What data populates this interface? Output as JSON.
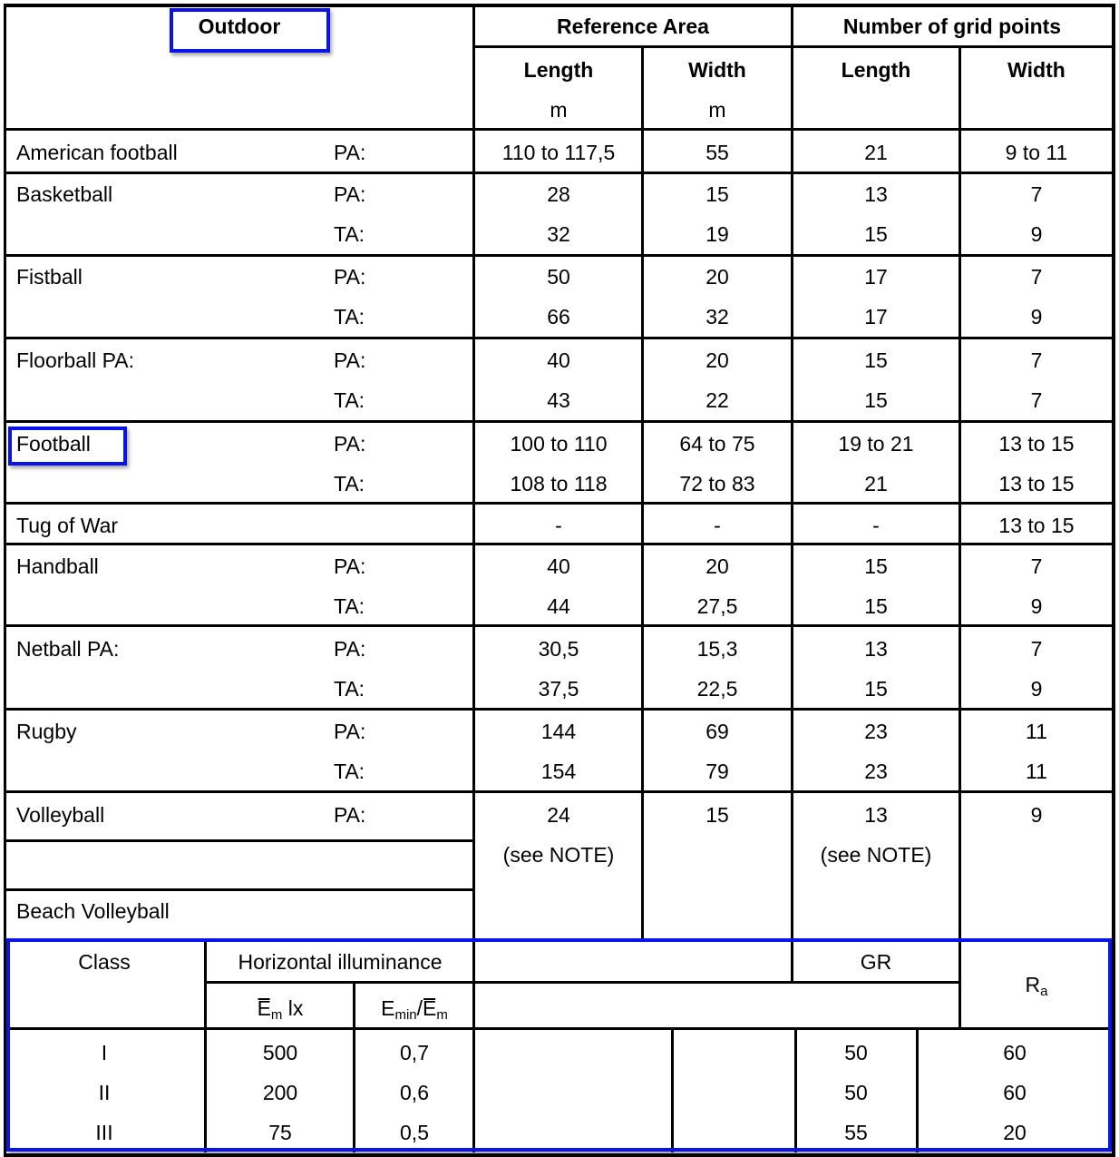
{
  "table": {
    "header": {
      "outdoor": "Outdoor",
      "reference_area": "Reference Area",
      "grid_points": "Number of grid points",
      "ref_length": "Length",
      "ref_width": "Width",
      "ref_length_unit": "m",
      "ref_width_unit": "m",
      "grid_length": "Length",
      "grid_width": "Width"
    },
    "rows": [
      {
        "sport": "American football",
        "lines": [
          {
            "area": "PA:",
            "ref_length": "110 to 117,5",
            "ref_width": "55",
            "grid_length": "21",
            "grid_width": "9 to 11"
          }
        ]
      },
      {
        "sport": "Basketball",
        "lines": [
          {
            "area": "PA:",
            "ref_length": "28",
            "ref_width": "15",
            "grid_length": "13",
            "grid_width": "7"
          },
          {
            "area": "TA:",
            "ref_length": "32",
            "ref_width": "19",
            "grid_length": "15",
            "grid_width": "9"
          }
        ]
      },
      {
        "sport": "Fistball",
        "lines": [
          {
            "area": "PA:",
            "ref_length": "50",
            "ref_width": "20",
            "grid_length": "17",
            "grid_width": "7"
          },
          {
            "area": "TA:",
            "ref_length": "66",
            "ref_width": "32",
            "grid_length": "17",
            "grid_width": "9"
          }
        ]
      },
      {
        "sport": "Floorball PA:",
        "lines": [
          {
            "area": "PA:",
            "ref_length": "40",
            "ref_width": "20",
            "grid_length": "15",
            "grid_width": "7"
          },
          {
            "area": "TA:",
            "ref_length": "43",
            "ref_width": "22",
            "grid_length": "15",
            "grid_width": "7"
          }
        ]
      },
      {
        "sport": "Football",
        "lines": [
          {
            "area": "PA:",
            "ref_length": "100 to 110",
            "ref_width": "64 to 75",
            "grid_length": "19 to 21",
            "grid_width": "13 to 15"
          },
          {
            "area": "TA:",
            "ref_length": "108 to 118",
            "ref_width": "72 to 83",
            "grid_length": "21",
            "grid_width": "13 to 15"
          }
        ]
      },
      {
        "sport": "Tug of War",
        "lines": [
          {
            "area": "",
            "ref_length": "-",
            "ref_width": "-",
            "grid_length": "-",
            "grid_width": "13 to 15"
          }
        ]
      },
      {
        "sport": "Handball",
        "lines": [
          {
            "area": "PA:",
            "ref_length": "40",
            "ref_width": "20",
            "grid_length": "15",
            "grid_width": "7"
          },
          {
            "area": "TA:",
            "ref_length": "44",
            "ref_width": "27,5",
            "grid_length": "15",
            "grid_width": "9"
          }
        ]
      },
      {
        "sport": "Netball PA:",
        "lines": [
          {
            "area": "PA:",
            "ref_length": "30,5",
            "ref_width": "15,3",
            "grid_length": "13",
            "grid_width": "7"
          },
          {
            "area": "TA:",
            "ref_length": "37,5",
            "ref_width": "22,5",
            "grid_length": "15",
            "grid_width": "9"
          }
        ]
      },
      {
        "sport": "Rugby",
        "lines": [
          {
            "area": "PA:",
            "ref_length": "144",
            "ref_width": "69",
            "grid_length": "23",
            "grid_width": "11"
          },
          {
            "area": "TA:",
            "ref_length": "154",
            "ref_width": "79",
            "grid_length": "23",
            "grid_width": "11"
          }
        ]
      },
      {
        "sport": "Volleyball",
        "lines": [
          {
            "area": "PA:",
            "ref_length": "24",
            "ref_width": "15",
            "grid_length": "13",
            "grid_width": "9"
          },
          {
            "area": "",
            "ref_length": "(see NOTE)",
            "ref_width": "",
            "grid_length": "(see NOTE)",
            "grid_width": ""
          }
        ]
      },
      {
        "sport": "Beach Volleyball",
        "lines": []
      }
    ]
  },
  "lighting": {
    "class_header": "Class",
    "horizontal_illuminance": "Horizontal illuminance",
    "em_label": "E",
    "em_sub": "m",
    "em_unit": " lx",
    "emin_label": "E",
    "emin_sub": "min",
    "emin_sep": "/E",
    "emin_sub2": "m",
    "gr_header": "GR",
    "ra_label": "R",
    "ra_sub": "a",
    "rows": [
      {
        "class": "I",
        "em": "500",
        "ratio": "0,7",
        "gr": "50",
        "ra": "60"
      },
      {
        "class": "II",
        "em": "200",
        "ratio": "0,6",
        "gr": "50",
        "ra": "60"
      },
      {
        "class": "III",
        "em": "75",
        "ratio": "0,5",
        "gr": "55",
        "ra": "20"
      }
    ]
  },
  "highlight_color": "#0a14e6"
}
